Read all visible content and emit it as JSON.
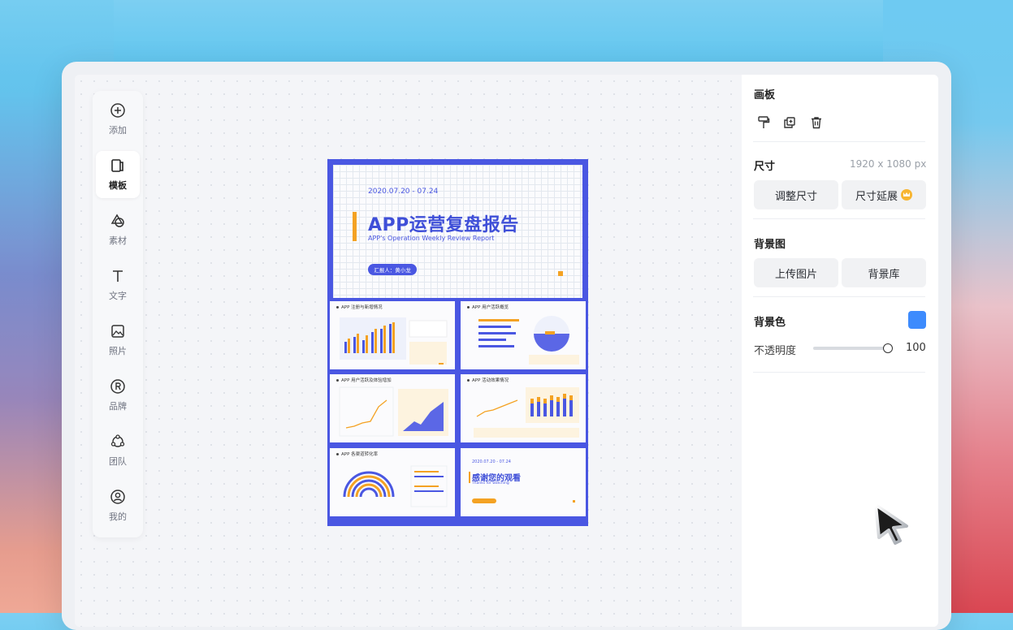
{
  "toolbar": {
    "items": [
      {
        "label": "添加",
        "icon": "plus-circle-icon"
      },
      {
        "label": "模板",
        "icon": "template-icon"
      },
      {
        "label": "素材",
        "icon": "shapes-icon"
      },
      {
        "label": "文字",
        "icon": "text-icon"
      },
      {
        "label": "照片",
        "icon": "image-icon"
      },
      {
        "label": "品牌",
        "icon": "registered-icon"
      },
      {
        "label": "团队",
        "icon": "team-icon"
      },
      {
        "label": "我的",
        "icon": "user-icon"
      }
    ],
    "active_index": 1
  },
  "poster": {
    "cover": {
      "date": "2020.07.20 - 07.24",
      "title": "APP运营复盘报告",
      "subtitle": "APP's Operation Weekly Review Report",
      "reporter": "汇报人：黄小龙"
    },
    "slides": [
      {
        "title": "APP 注册与新增情况"
      },
      {
        "title": "APP 用户活跃概览"
      },
      {
        "title": "APP 用户活跃及体验增加"
      },
      {
        "title": "APP 活动效果情况"
      },
      {
        "title": "APP 各渠道转化率"
      },
      {
        "date": "2020.07.20 - 07.24",
        "title": "感谢您的观看",
        "subtitle": "Thanks for watching"
      }
    ]
  },
  "panel": {
    "section_title": "画板",
    "size": {
      "label": "尺寸",
      "value": "1920 x 1080 px",
      "resize_button": "调整尺寸",
      "extend_button": "尺寸延展"
    },
    "background_image": {
      "label": "背景图",
      "upload_button": "上传图片",
      "library_button": "背景库"
    },
    "background_color": {
      "label": "背景色",
      "color": "#3d8bfd",
      "opacity_label": "不透明度",
      "opacity_value": "100",
      "opacity": 1.0
    }
  },
  "colors": {
    "accent_blue": "#4a57e2",
    "accent_orange": "#f4a223"
  }
}
